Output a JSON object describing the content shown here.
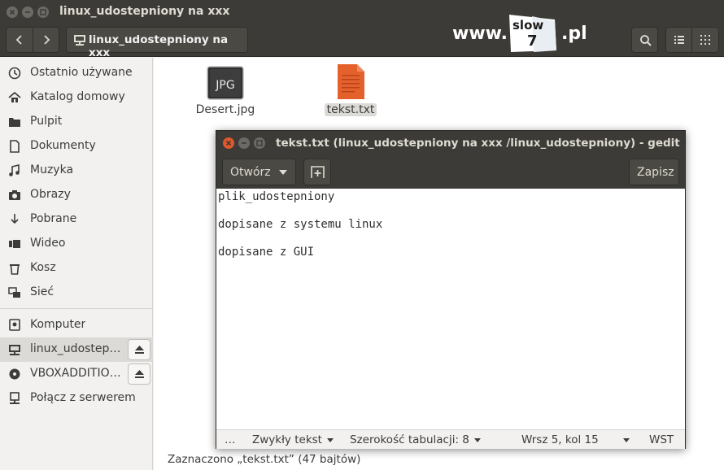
{
  "window": {
    "title": "linux_udostepniony na xxx"
  },
  "toolbar": {
    "path_label": "linux_udostepniony na xxx"
  },
  "logo": {
    "prefix": "www.",
    "word_top": "slow",
    "word_bottom": "7",
    "suffix": ".pl"
  },
  "sidebar": {
    "items": [
      {
        "label": "Ostatnio używane",
        "icon": "clock-icon"
      },
      {
        "label": "Katalog domowy",
        "icon": "home-icon"
      },
      {
        "label": "Pulpit",
        "icon": "folder-icon"
      },
      {
        "label": "Dokumenty",
        "icon": "document-icon"
      },
      {
        "label": "Muzyka",
        "icon": "music-icon"
      },
      {
        "label": "Obrazy",
        "icon": "camera-icon"
      },
      {
        "label": "Pobrane",
        "icon": "download-icon"
      },
      {
        "label": "Wideo",
        "icon": "video-icon"
      },
      {
        "label": "Kosz",
        "icon": "trash-icon"
      },
      {
        "label": "Sieć",
        "icon": "network-icon"
      }
    ],
    "devices": [
      {
        "label": "Komputer",
        "icon": "computer-icon"
      },
      {
        "label": "linux_udostep…",
        "icon": "network-drive-icon",
        "selected": true,
        "eject": true
      },
      {
        "label": "VBOXADDITIO…",
        "icon": "disc-icon",
        "eject": true
      },
      {
        "label": "Połącz z serwerem",
        "icon": "server-icon"
      }
    ]
  },
  "files": [
    {
      "name": "Desert.jpg",
      "thumb_text": "JPG"
    },
    {
      "name": "tekst.txt",
      "selected": true
    }
  ],
  "statusbar": {
    "text": "Zaznaczono „tekst.txt” (47 bajtów)"
  },
  "gedit": {
    "title": "tekst.txt (linux_udostepniony na xxx /linux_udostepniony) - gedit",
    "open_label": "Otwórz",
    "save_label": "Zapisz",
    "lines": [
      "plik_udostepniony",
      "",
      "dopisane z systemu linux",
      "",
      "dopisane z GUI"
    ],
    "status": {
      "ellipsis": "…",
      "language": "Zwykły tekst",
      "tab_width": "Szerokość tabulacji: 8",
      "position": "Wrsz 5, kol 15",
      "mode": "WST"
    }
  }
}
